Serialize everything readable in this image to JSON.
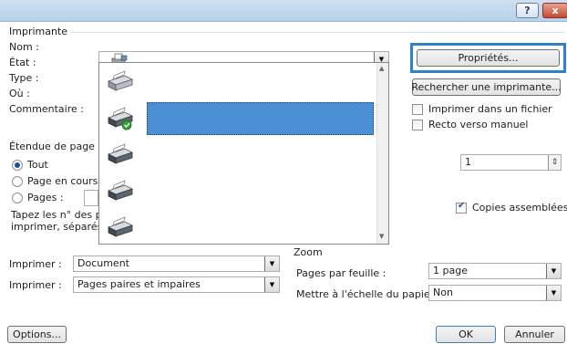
{
  "titlebar": {
    "help_label": "?",
    "close_label": "x"
  },
  "printer_group": {
    "title": "Imprimante",
    "name_label": "Nom :",
    "status_label": "État :",
    "type_label": "Type :",
    "where_label": "Où :",
    "comment_label": "Commentaire :",
    "properties_button": "Propriétés...",
    "find_printer_button": "Rechercher une imprimante...",
    "print_to_file_label": "Imprimer dans un fichier",
    "manual_duplex_label": "Recto verso manuel"
  },
  "page_range": {
    "title": "Étendue de page",
    "all_label": "Tout",
    "current_label": "Page en cours",
    "pages_label": "Pages :",
    "hint_line1": "Tapez les n° des p",
    "hint_line2": "imprimer, séparés"
  },
  "copies": {
    "value": "1",
    "collate_label": "Copies assemblées"
  },
  "print_what": {
    "label": "Imprimer :",
    "value": "Document"
  },
  "print_pages": {
    "label": "Imprimer :",
    "value": "Pages paires et impaires"
  },
  "zoom": {
    "title": "Zoom",
    "pages_per_sheet_label": "Pages par feuille :",
    "pages_per_sheet_value": "1 page",
    "scale_label": "Mettre à l'échelle du papier :",
    "scale_value": "Non"
  },
  "footer": {
    "options_button": "Options...",
    "ok_button": "OK",
    "cancel_button": "Annuler"
  },
  "printer_list": {
    "selected_index": 2,
    "count": 6
  }
}
